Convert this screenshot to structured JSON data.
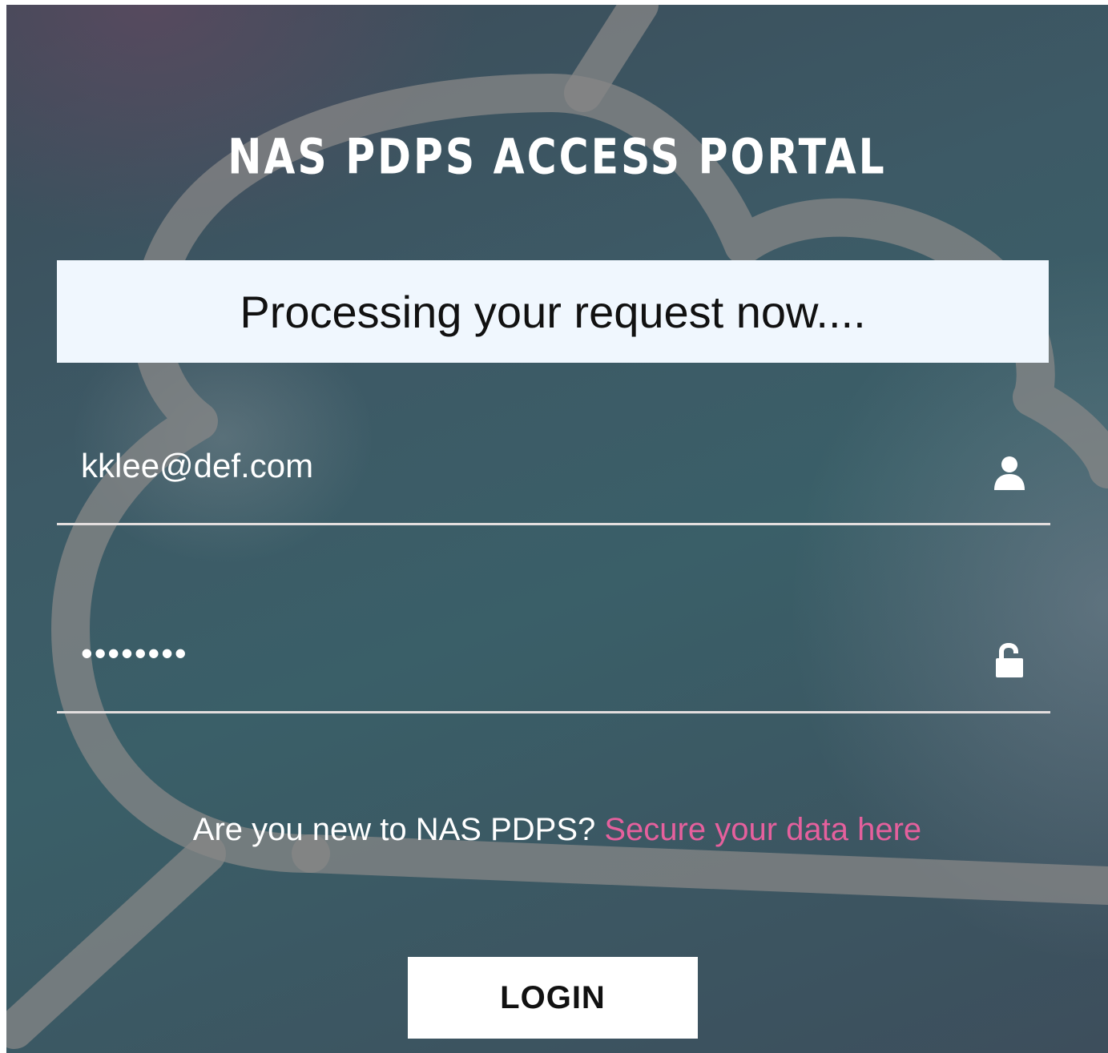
{
  "portal": {
    "title": "NAS PDPS ACCESS PORTAL",
    "status_message": "Processing your request now....",
    "email_value": "kklee@def.com",
    "password_value": "••••••••",
    "signup_prompt": "Are you new to NAS PDPS?",
    "signup_link": "Secure your data here",
    "login_label": "LOGIN"
  },
  "icons": {
    "email": "user-icon",
    "password": "unlock-icon"
  },
  "colors": {
    "link": "#e5609d",
    "banner": "#f0f7fe",
    "background": "#3d5a66"
  }
}
